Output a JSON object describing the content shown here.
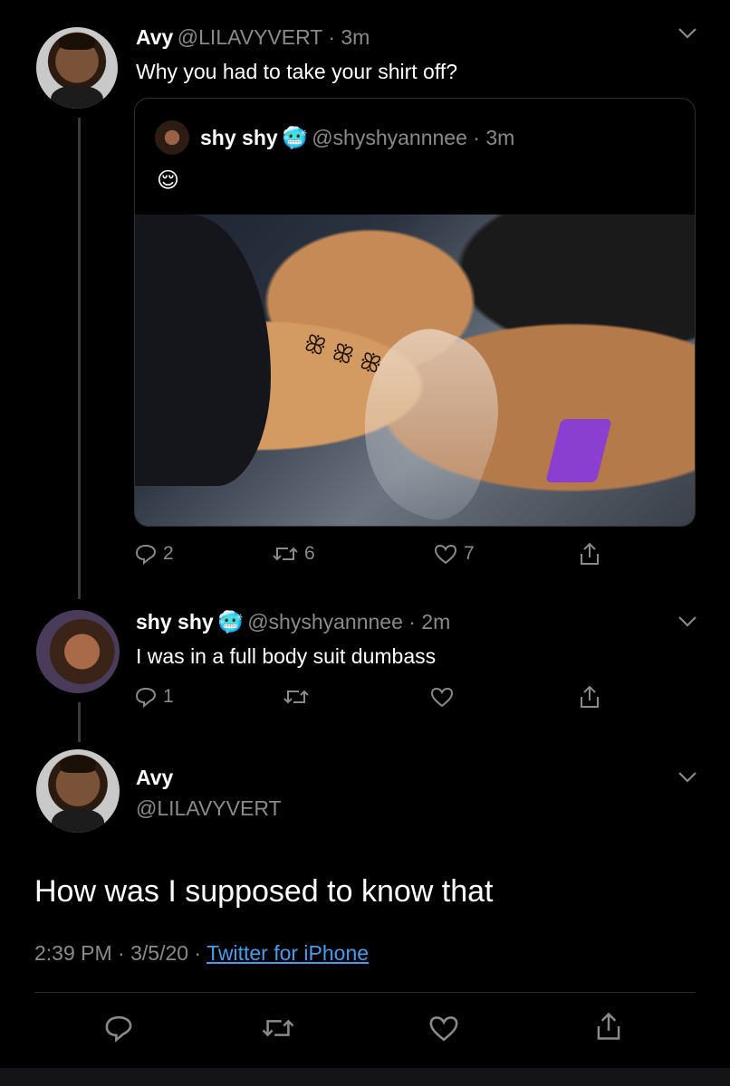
{
  "tweet1": {
    "name": "Avy",
    "handle_time": "@LILAVYVERT · 3m",
    "text": "Why you had to take your shirt off?"
  },
  "quoted": {
    "name": "shy shy",
    "emoji": "🥶",
    "handle_time": "@shyshyannnee · 3m",
    "text": "😌",
    "replies": "2",
    "retweets": "6",
    "likes": "7"
  },
  "tweet2": {
    "name": "shy shy",
    "emoji": "🥶",
    "handle_time": "@shyshyannnee · 2m",
    "text": "I was in a full body suit dumbass",
    "replies": "1"
  },
  "main": {
    "name": "Avy",
    "handle": "@LILAVYVERT",
    "text": "How was I supposed to know that",
    "time": "2:39 PM · 3/5/20 · ",
    "source": "Twitter for iPhone"
  },
  "colors": {
    "background": "#000000",
    "muted": "#8a8a8a",
    "link": "#4a9ce8"
  }
}
